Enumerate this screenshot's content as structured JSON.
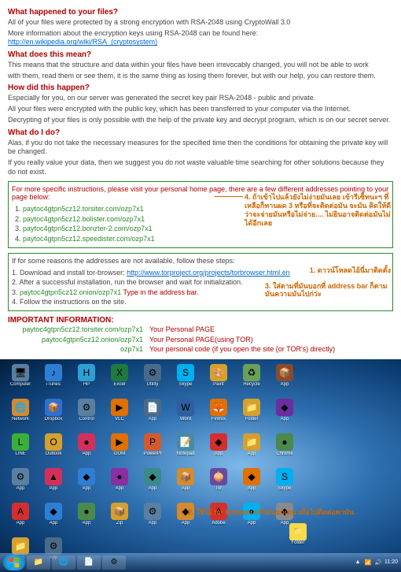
{
  "section1": {
    "heading": "What happened to your files?",
    "line1": "All of your files were protected by a strong encryption with RSA-2048 using CryptoWall 3.0",
    "line2_a": "More information about the encryption keys using RSA-2048 can be found here: ",
    "line2_link": "http://en.wikipedia.org/wiki/RSA_(cryptosystem)"
  },
  "section2": {
    "heading": "What does this mean?",
    "line1": "This means that the structure and data within your files have been irrevocably changed, you will not be able to work",
    "line2": "with them, read them or see them, it is the same thing as losing them forever, but with our help, you can restore them."
  },
  "section3": {
    "heading": "How did this happen?",
    "line1": "Especially for you, on our server was generated the secret key pair RSA-2048 - public and private.",
    "line2": "All your files were encrypted with the public key, which has been transferred to your computer via the Internet.",
    "line3": "Decrypting of your files is only possible with the help of the private key and decrypt program, which is on our secret server."
  },
  "section4": {
    "heading": "What do I do?",
    "line1": "Alas, if you do not take the necessary measures for the specified time then the conditions for obtaining the private key will be changed.",
    "line2": "If you really value your data, then we suggest you do not waste valuable time searching for other solutions because they do not exist."
  },
  "greenbox": {
    "title": "For more specific instructions, please visit your personal home page, there are a few different addresses pointing to your page below:",
    "urls": [
      "paytoc4gtpn5cz12.torsiter.com/ozp7x1",
      "paytoc4gtpn5cz12.bolister.com/ozp7x1",
      "paytoc4gtpn5cz12.bonzter-2.com/ozp7x1",
      "paytoc4gtpn5cz12.speedister.com/ozp7x1"
    ]
  },
  "annotation4": "4. ถ้าเข้าไปแล้วยังไม่ง่ายมันเลย เข้ารีเซ็ทนะฯ ที่เหลือก็ทานผด 3 หรือที่จะติดต่อมัน จะมัน คิดให้ดีว่าจะจ่ายมันหรือไม่จ่าย.... ไม่ยินอาจติดต่อมันไม่ได้อีกเลย",
  "stepsbox": {
    "title": "If for some reasons the addresses are not available, follow these steps:",
    "step1_a": "1. Download and install tor-browser: ",
    "step1_link": "http://www.torproject.org/projects/torbrowser.html.en",
    "step2": "2. After a successful installation, run the browser and wait for initialization.",
    "step3_a": "3. ",
    "step3_green": "paytoc4gtpn5cz12.onion/ozp7x1",
    "step3_red": " Type in the address bar.",
    "step4": "4. Follow the instructions on the site."
  },
  "annotation1": "1. ดาวน์โหลดไอ้นี่มาติดตั้ง",
  "annotation3": "3. ใส่ตามที่มันบอกที่ address bar ก็ตามมันความมันไปก่ว่ะ",
  "important": {
    "title": "IMPORTANT INFORMATION:",
    "row1_left": "paytoc4gtpn5cz12.torsiter.com/ozp7x1",
    "row1_right": "Your Personal PAGE",
    "row2_left": "paytoc4gtpn5cz12.onion/ozp7x1",
    "row2_right": "Your Personal PAGE(using TOR)",
    "row3_left": "ozp7x1",
    "row3_right": "Your personal code (if you open the site (or TOR's) directly)"
  },
  "annotation2": "2. ใช้ไอ้ tor browser เข้ามันนาเดน เมื่อไปติดต่อพามัน",
  "desktop": {
    "icons": [
      {
        "label": "Computer",
        "color": "#5a7fa0",
        "glyph": "🖥"
      },
      {
        "label": "iTunes",
        "color": "#2e7fd4",
        "glyph": "♪"
      },
      {
        "label": "HP",
        "color": "#2e9fd4",
        "glyph": "H"
      },
      {
        "label": "Excel",
        "color": "#1e7a3e",
        "glyph": "X"
      },
      {
        "label": "Utility",
        "color": "#4a6a8a",
        "glyph": "⚙"
      },
      {
        "label": "Skype",
        "color": "#00aff0",
        "glyph": "S"
      },
      {
        "label": "Paint",
        "color": "#d4a02e",
        "glyph": "🎨"
      },
      {
        "label": "Recycle",
        "color": "#6aa05a",
        "glyph": "♻"
      },
      {
        "label": "App",
        "color": "#8a4a2e",
        "glyph": "📦"
      },
      {
        "label": "Network",
        "color": "#d48a2e",
        "glyph": "🌐"
      },
      {
        "label": "Dropbox",
        "color": "#2e6fd4",
        "glyph": "📦"
      },
      {
        "label": "Control",
        "color": "#5a7fa0",
        "glyph": "⚙"
      },
      {
        "label": "VLC",
        "color": "#e07000",
        "glyph": "▶"
      },
      {
        "label": "App",
        "color": "#4a6a8a",
        "glyph": "📄"
      },
      {
        "label": "Word",
        "color": "#2e5fa0",
        "glyph": "W"
      },
      {
        "label": "Firefox",
        "color": "#e07000",
        "glyph": "🦊"
      },
      {
        "label": "Folder",
        "color": "#d4a02e",
        "glyph": "📁"
      },
      {
        "label": "App",
        "color": "#6a2ea0",
        "glyph": "◆"
      },
      {
        "label": "LINE",
        "color": "#3ab03a",
        "glyph": "L"
      },
      {
        "label": "Outlook",
        "color": "#d4a02e",
        "glyph": "O"
      },
      {
        "label": "App",
        "color": "#d42e5a",
        "glyph": "●"
      },
      {
        "label": "GOM",
        "color": "#e07000",
        "glyph": "▶"
      },
      {
        "label": "PowerPt",
        "color": "#d45a2e",
        "glyph": "P"
      },
      {
        "label": "Notepad",
        "color": "#4a8aa0",
        "glyph": "📝"
      },
      {
        "label": "App",
        "color": "#d42e2e",
        "glyph": "◆"
      },
      {
        "label": "App",
        "color": "#d4a02e",
        "glyph": "📁"
      },
      {
        "label": "Chrome",
        "color": "#4a8a4a",
        "glyph": "●"
      },
      {
        "label": "App",
        "color": "#5a7fa0",
        "glyph": "⚙"
      },
      {
        "label": "App",
        "color": "#d42e5a",
        "glyph": "▲"
      },
      {
        "label": "App",
        "color": "#2e7fd4",
        "glyph": "◆"
      },
      {
        "label": "App",
        "color": "#8a2ea0",
        "glyph": "●"
      },
      {
        "label": "App",
        "color": "#3a8a8a",
        "glyph": "◆"
      },
      {
        "label": "App",
        "color": "#d48a2e",
        "glyph": "📦"
      },
      {
        "label": "Tor",
        "color": "#6a4aa0",
        "glyph": "🧅"
      },
      {
        "label": "App",
        "color": "#e07000",
        "glyph": "◆"
      },
      {
        "label": "Skype",
        "color": "#00aff0",
        "glyph": "S"
      },
      {
        "label": "App",
        "color": "#d42e2e",
        "glyph": "A"
      },
      {
        "label": "App",
        "color": "#2e7fd4",
        "glyph": "◆"
      },
      {
        "label": "App",
        "color": "#4a8a4a",
        "glyph": "●"
      },
      {
        "label": "Zip",
        "color": "#d4a02e",
        "glyph": "📦"
      },
      {
        "label": "App",
        "color": "#5a7fa0",
        "glyph": "⚙"
      },
      {
        "label": "App",
        "color": "#d48a2e",
        "glyph": "◆"
      },
      {
        "label": "Adobe",
        "color": "#d42e2e",
        "glyph": "A"
      },
      {
        "label": "App",
        "color": "#00aff0",
        "glyph": "●"
      },
      {
        "label": "App",
        "color": "#8a8a8a",
        "glyph": "◆"
      },
      {
        "label": "App",
        "color": "#d4a02e",
        "glyph": "📁"
      },
      {
        "label": "App",
        "color": "#4a6a8a",
        "glyph": "⚙"
      }
    ]
  },
  "spare_icon_label": "Folder",
  "taskbar": {
    "time": "11:20"
  }
}
